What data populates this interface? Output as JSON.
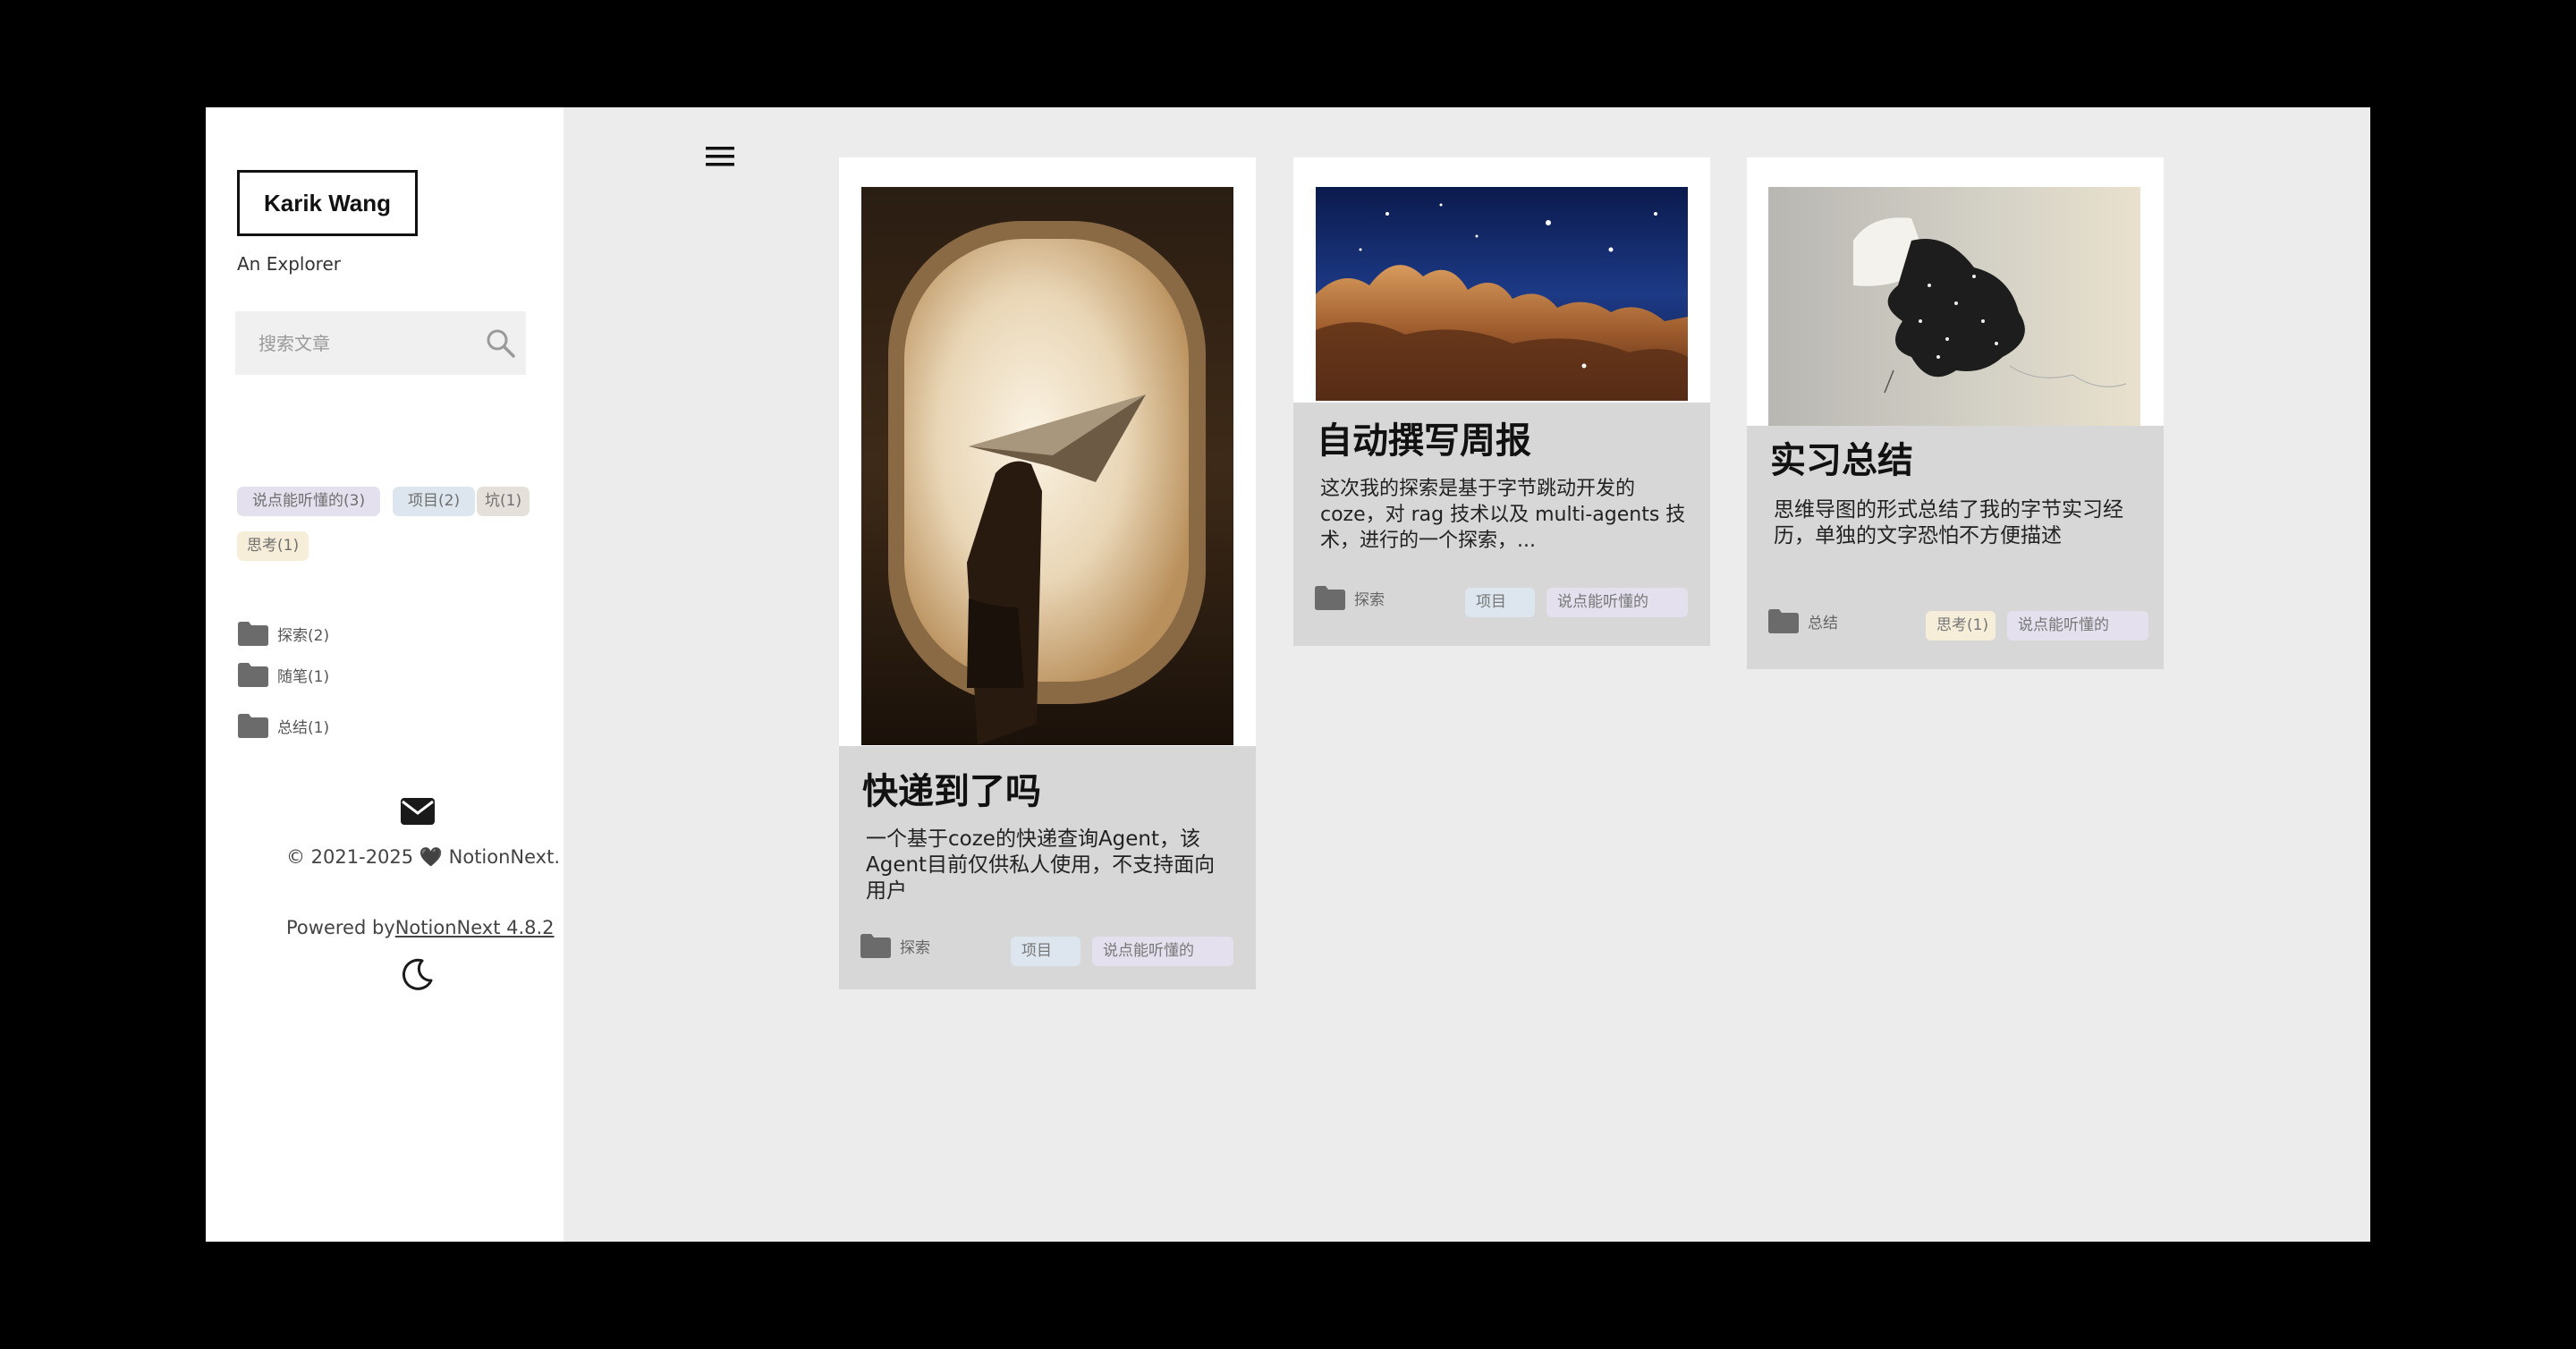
{
  "sidebar": {
    "logo": "Karik Wang",
    "subtitle": "An Explorer",
    "search_placeholder": "搜索文章",
    "tags": [
      "说点能听懂的(3)",
      "项目(2)",
      "坑(1)",
      "思考(1)"
    ],
    "categories": [
      "探索(2)",
      "随笔(1)",
      "总结(1)"
    ],
    "copyright": "© 2021-2025 🖤 NotionNext.",
    "powered_prefix": "Powered by",
    "powered_link": "NotionNext 4.8.2"
  },
  "posts": [
    {
      "title": "快递到了吗",
      "summary": "一个基于coze的快递查询Agent，该Agent目前仅供私人使用，不支持面向用户",
      "category": "探索",
      "tags": [
        "项目",
        "说点能听懂的"
      ]
    },
    {
      "title": "自动撰写周报",
      "summary": "这次我的探索是基于字节跳动开发的coze，对 rag 技术以及 multi-agents 技术，进行的一个探索，...",
      "category": "探索",
      "tags": [
        "项目",
        "说点能听懂的"
      ]
    },
    {
      "title": "实习总结",
      "summary": "思维导图的形式总结了我的字节实习经历，单独的文字恐怕不方便描述",
      "category": "总结",
      "tags": [
        "思考(1)",
        "说点能听懂的"
      ]
    }
  ],
  "colors": {
    "tag_purple": "#e4e0ee",
    "tag_blue": "#dde6ee",
    "tag_brown": "#e6e0da",
    "tag_yellow": "#f7eeda",
    "card_body": "#d7d7d7",
    "main_bg": "#ececec"
  }
}
